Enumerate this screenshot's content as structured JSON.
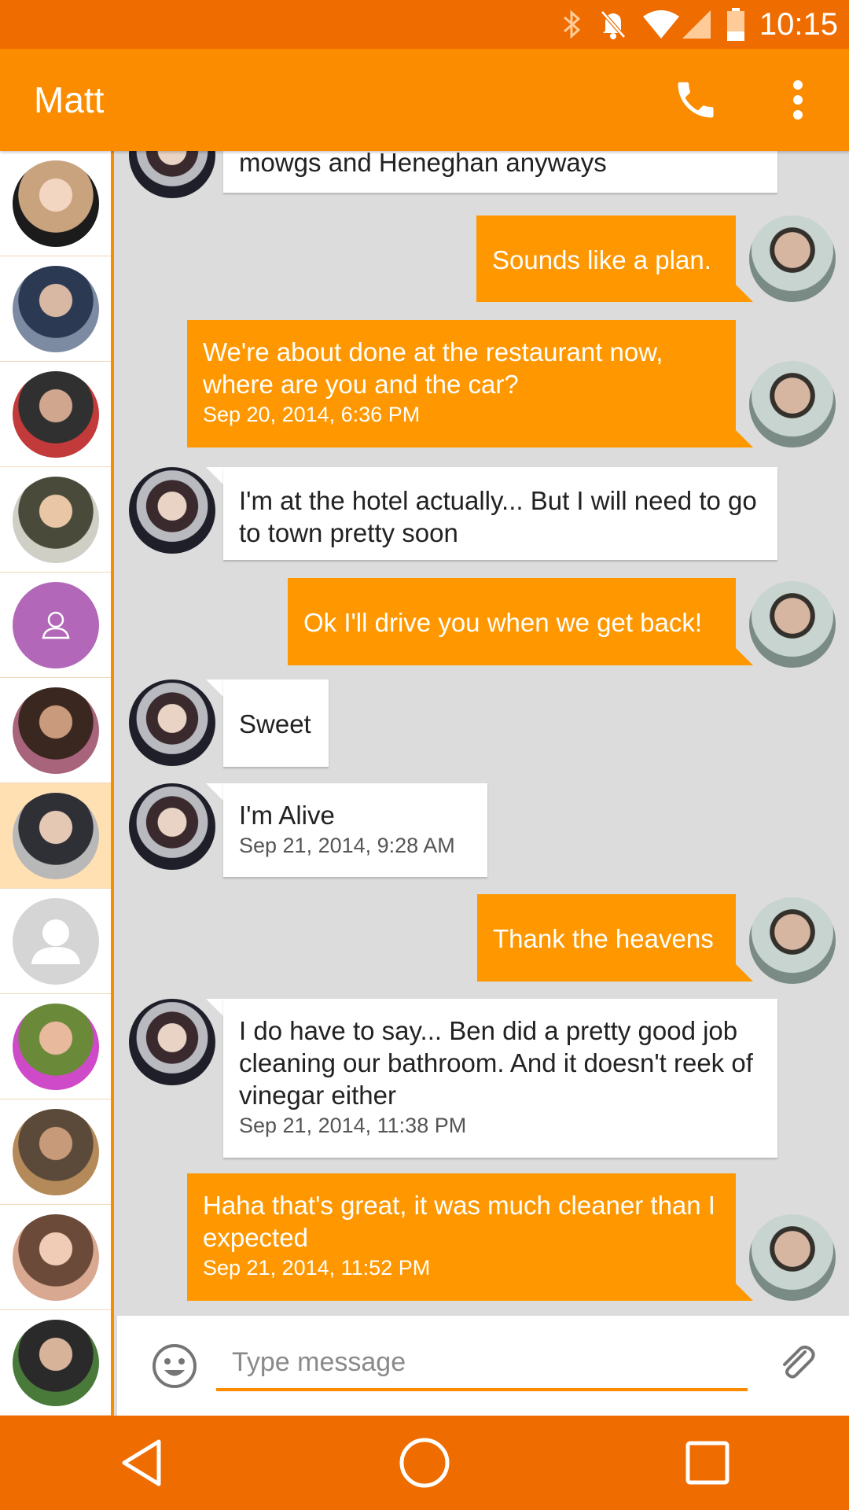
{
  "status_bar": {
    "time": "10:15"
  },
  "header": {
    "title": "Matt"
  },
  "contacts": [
    {
      "colors": [
        "#f2d6c2",
        "#c9a27e",
        "#1b1b1b"
      ]
    },
    {
      "colors": [
        "#d9b8a3",
        "#2b3a52",
        "#7c8aa2"
      ]
    },
    {
      "colors": [
        "#d0a68e",
        "#303030",
        "#c23a3a"
      ]
    },
    {
      "colors": [
        "#e8c6a6",
        "#4a4a3a",
        "#cfcfc6"
      ]
    },
    {
      "colors": [
        "#b267b8"
      ]
    },
    {
      "colors": [
        "#c99a7c",
        "#3a2820",
        "#a8647a"
      ]
    },
    {
      "colors": [
        "#e5c8b4",
        "#2f2f36",
        "#b8b8b8"
      ]
    },
    {
      "colors": [
        "#d5d5d5"
      ]
    },
    {
      "colors": [
        "#e8b99c",
        "#6a8a3a",
        "#cf4ac8"
      ]
    },
    {
      "colors": [
        "#c79a7a",
        "#5b4a3a",
        "#b58a5a"
      ]
    },
    {
      "colors": [
        "#f0ccb6",
        "#6b4a3a",
        "#d8a890"
      ]
    },
    {
      "colors": [
        "#d7b39a",
        "#2a2a2a",
        "#4a7a3a"
      ]
    }
  ],
  "messages": [
    {
      "dir": "in",
      "text": "mowgs and Heneghan anyways",
      "time": ""
    },
    {
      "dir": "out",
      "text": "Sounds like a plan.",
      "time": ""
    },
    {
      "dir": "out",
      "text": "We're about done at the restaurant now, where are you and the car?",
      "time": "Sep 20, 2014, 6:36 PM"
    },
    {
      "dir": "in",
      "text": "I'm at the hotel actually... But I will need to go to town pretty soon",
      "time": ""
    },
    {
      "dir": "out",
      "text": "Ok I'll drive you when we get back!",
      "time": ""
    },
    {
      "dir": "in",
      "text": "Sweet",
      "time": ""
    },
    {
      "dir": "in",
      "text": "I'm Alive",
      "time": "Sep 21, 2014, 9:28 AM"
    },
    {
      "dir": "out",
      "text": "Thank the heavens",
      "time": ""
    },
    {
      "dir": "in",
      "text": "I do have to say... Ben did a pretty good job cleaning our bathroom. And it doesn't reek of vinegar either",
      "time": "Sep 21, 2014, 11:38 PM"
    },
    {
      "dir": "out",
      "text": "Haha that's great, it was much cleaner than I expected",
      "time": "Sep 21, 2014, 11:52 PM"
    }
  ],
  "composer": {
    "placeholder": "Type message"
  },
  "colors": {
    "status_bar": "#ef6c00",
    "app_bar": "#fb8c00",
    "outgoing": "#ff9800",
    "incoming": "#ffffff",
    "background": "#dcdcdc"
  },
  "icons": [
    "bluetooth-icon",
    "bell-off-icon",
    "wifi-icon",
    "signal-icon",
    "battery-icon",
    "phone-icon",
    "more-vert-icon",
    "emoji-icon",
    "attach-icon",
    "back-icon",
    "home-icon",
    "recents-icon"
  ]
}
